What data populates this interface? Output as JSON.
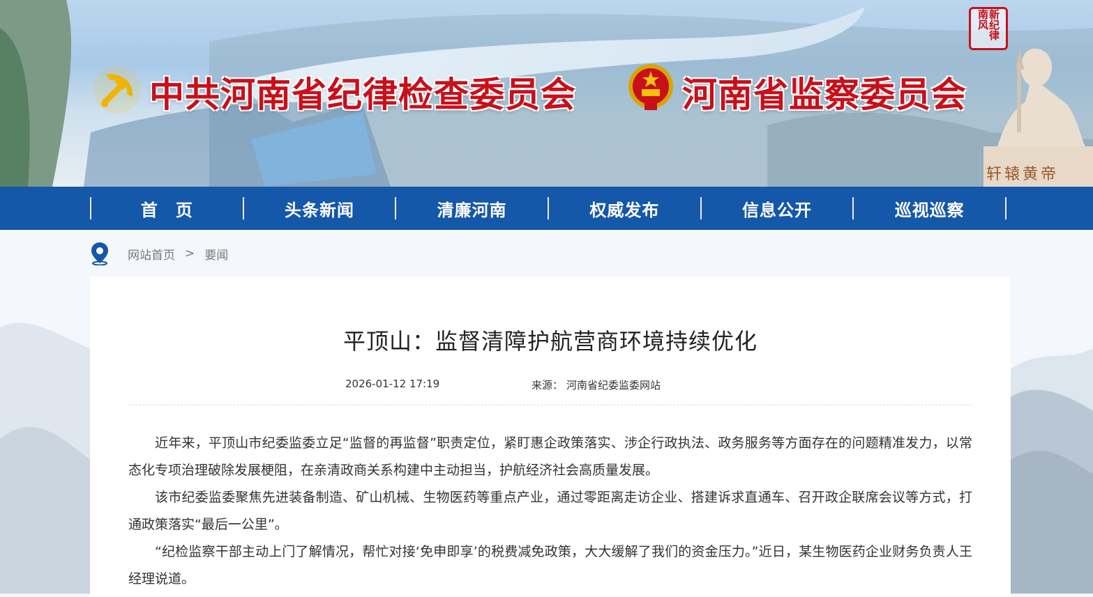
{
  "header": {
    "title_left": "中共河南省纪律检查委员会",
    "title_right": "河南省监察委员会",
    "seal_text": "新纪律南风",
    "statue_caption": "轩辕黄帝"
  },
  "nav": {
    "items": [
      {
        "label": "首　页"
      },
      {
        "label": "头条新闻"
      },
      {
        "label": "清廉河南"
      },
      {
        "label": "权威发布"
      },
      {
        "label": "信息公开"
      },
      {
        "label": "巡视巡察"
      }
    ]
  },
  "breadcrumb": {
    "home": "网站首页",
    "separator": ">",
    "current": "要闻"
  },
  "article": {
    "title": "平顶山：监督清障护航营商环境持续优化",
    "date": "2026-01-12 17:19",
    "source_label": "来源：",
    "source": "河南省纪委监委网站",
    "paragraphs": [
      "近年来，平顶山市纪委监委立足“监督的再监督”职责定位，紧盯惠企政策落实、涉企行政执法、政务服务等方面存在的问题精准发力，以常态化专项治理破除发展梗阻，在亲清政商关系构建中主动担当，护航经济社会高质量发展。",
      "该市纪委监委聚焦先进装备制造、矿山机械、生物医药等重点产业，通过零距离走访企业、搭建诉求直通车、召开政企联席会议等方式，打通政策落实“最后一公里”。",
      "“纪检监察干部主动上门了解情况，帮忙对接‘免申即享’的税费减免政策，大大缓解了我们的资金压力。”近日，某生物医药企业财务负责人王经理说道。"
    ]
  }
}
